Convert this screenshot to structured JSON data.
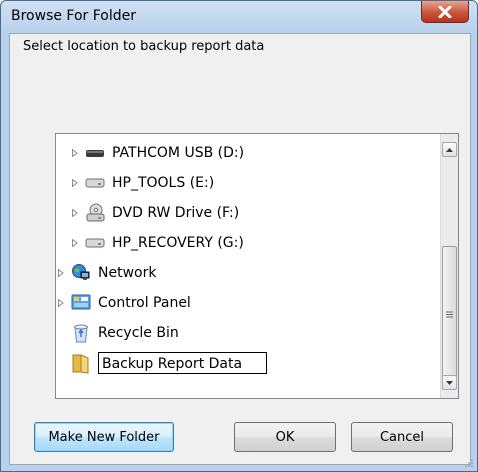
{
  "window": {
    "title": "Browse For Folder"
  },
  "prompt": "Select location to backup report data",
  "tree": {
    "items": [
      {
        "label": "PATHCOM USB (D:)",
        "icon": "usb-drive-icon",
        "expander": true
      },
      {
        "label": "HP_TOOLS (E:)",
        "icon": "hard-drive-icon",
        "expander": true
      },
      {
        "label": "DVD RW Drive (F:)",
        "icon": "dvd-drive-icon",
        "expander": true
      },
      {
        "label": "HP_RECOVERY (G:)",
        "icon": "hard-drive-icon",
        "expander": true
      },
      {
        "label": "Network",
        "icon": "network-icon",
        "expander": true
      },
      {
        "label": "Control Panel",
        "icon": "control-panel-icon",
        "expander": true
      },
      {
        "label": "Recycle Bin",
        "icon": "recycle-bin-icon",
        "expander": false
      },
      {
        "label": "Backup Report Data",
        "icon": "folder-icon",
        "expander": false,
        "editing": true
      }
    ]
  },
  "buttons": {
    "make_new_folder": "Make New Folder",
    "ok": "OK",
    "cancel": "Cancel"
  },
  "colors": {
    "title_bar": "#b9d1ec",
    "close_button": "#c8563b",
    "default_button_border": "#3c7fb1"
  }
}
